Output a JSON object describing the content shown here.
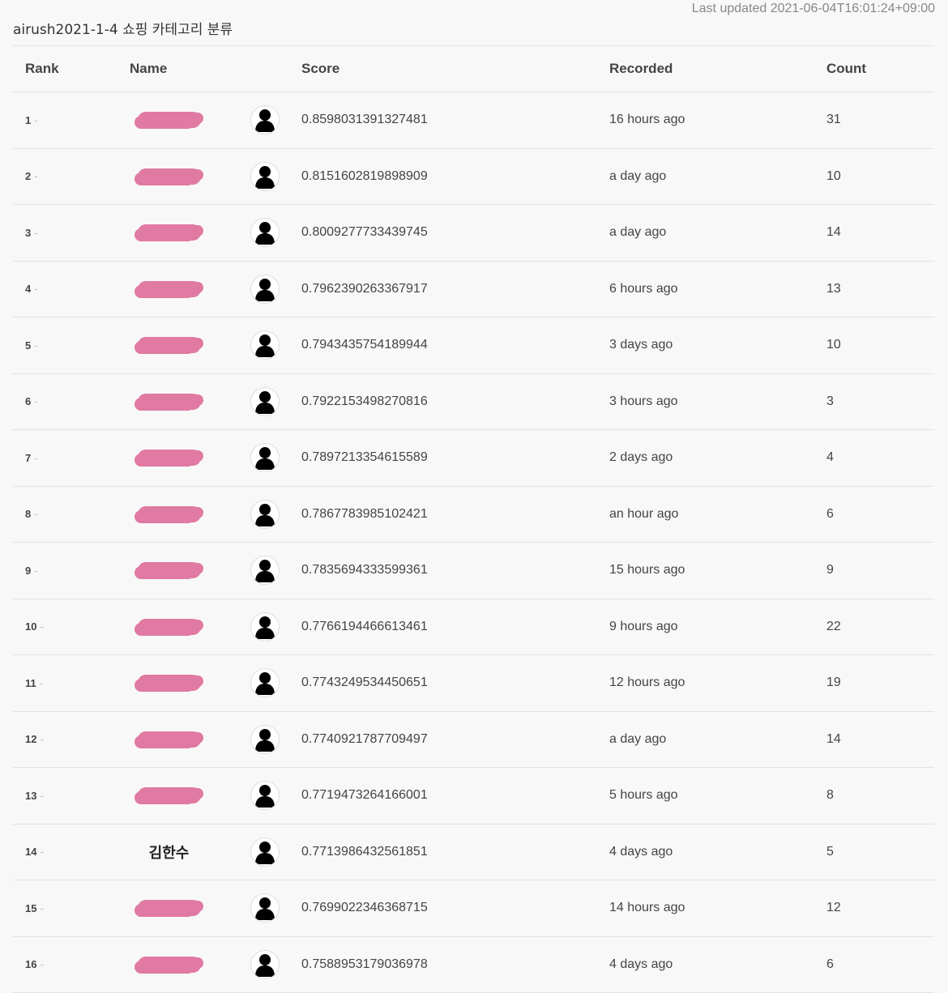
{
  "header": {
    "last_updated": "Last updated 2021-06-04T16:01:24+09:00",
    "title": "airush2021-1-4 쇼핑 카테고리 분류"
  },
  "columns": {
    "rank": "Rank",
    "name": "Name",
    "score": "Score",
    "recorded": "Recorded",
    "count": "Count"
  },
  "rows": [
    {
      "rank": "1",
      "name": "",
      "redacted": true,
      "score": "0.8598031391327481",
      "recorded": "16 hours ago",
      "count": "31"
    },
    {
      "rank": "2",
      "name": "",
      "redacted": true,
      "score": "0.8151602819898909",
      "recorded": "a day ago",
      "count": "10"
    },
    {
      "rank": "3",
      "name": "",
      "redacted": true,
      "score": "0.8009277733439745",
      "recorded": "a day ago",
      "count": "14"
    },
    {
      "rank": "4",
      "name": "",
      "redacted": true,
      "score": "0.7962390263367917",
      "recorded": "6 hours ago",
      "count": "13"
    },
    {
      "rank": "5",
      "name": "",
      "redacted": true,
      "score": "0.7943435754189944",
      "recorded": "3 days ago",
      "count": "10"
    },
    {
      "rank": "6",
      "name": "",
      "redacted": true,
      "score": "0.7922153498270816",
      "recorded": "3 hours ago",
      "count": "3"
    },
    {
      "rank": "7",
      "name": "",
      "redacted": true,
      "score": "0.7897213354615589",
      "recorded": "2 days ago",
      "count": "4"
    },
    {
      "rank": "8",
      "name": "",
      "redacted": true,
      "score": "0.7867783985102421",
      "recorded": "an hour ago",
      "count": "6"
    },
    {
      "rank": "9",
      "name": "",
      "redacted": true,
      "score": "0.7835694333599361",
      "recorded": "15 hours ago",
      "count": "9"
    },
    {
      "rank": "10",
      "name": "",
      "redacted": true,
      "score": "0.7766194466613461",
      "recorded": "9 hours ago",
      "count": "22"
    },
    {
      "rank": "11",
      "name": "",
      "redacted": true,
      "score": "0.7743249534450651",
      "recorded": "12 hours ago",
      "count": "19"
    },
    {
      "rank": "12",
      "name": "",
      "redacted": true,
      "score": "0.7740921787709497",
      "recorded": "a day ago",
      "count": "14"
    },
    {
      "rank": "13",
      "name": "",
      "redacted": true,
      "score": "0.7719473264166001",
      "recorded": "5 hours ago",
      "count": "8"
    },
    {
      "rank": "14",
      "name": "김한수",
      "redacted": false,
      "score": "0.7713986432561851",
      "recorded": "4 days ago",
      "count": "5"
    },
    {
      "rank": "15",
      "name": "",
      "redacted": true,
      "score": "0.7699022346368715",
      "recorded": "14 hours ago",
      "count": "12"
    },
    {
      "rank": "16",
      "name": "",
      "redacted": true,
      "score": "0.7588953179036978",
      "recorded": "4 days ago",
      "count": "6"
    }
  ],
  "icons": {
    "avatar": "user-silhouette-icon"
  },
  "colors": {
    "redaction": "#e07aa2"
  }
}
